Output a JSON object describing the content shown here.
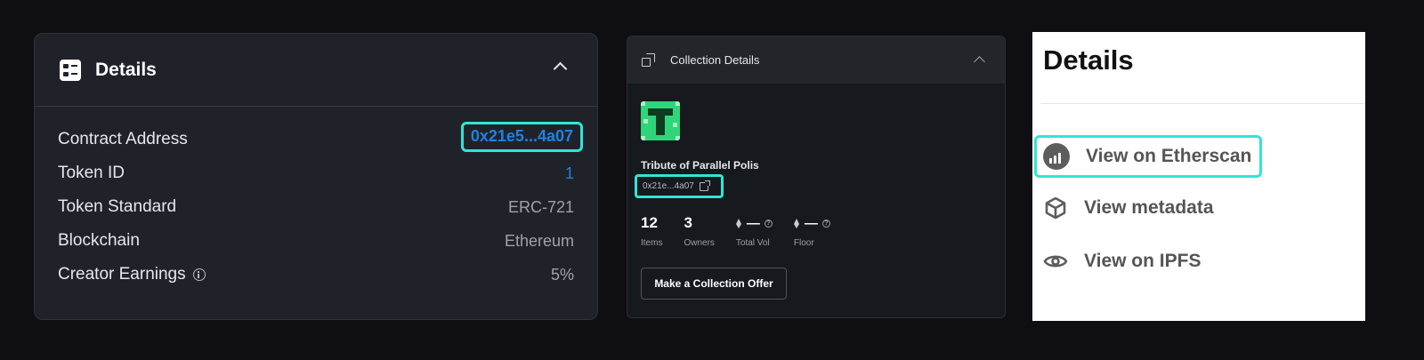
{
  "panel1": {
    "title": "Details",
    "rows": [
      {
        "label": "Contract Address",
        "value": "0x21e5...4a07"
      },
      {
        "label": "Token ID",
        "value": "1"
      },
      {
        "label": "Token Standard",
        "value": "ERC-721"
      },
      {
        "label": "Blockchain",
        "value": "Ethereum"
      },
      {
        "label": "Creator Earnings",
        "value": "5%"
      }
    ]
  },
  "panel2": {
    "title": "Collection Details",
    "collection_name": "Tribute of Parallel Polis",
    "address": "0x21e...4a07",
    "stats": [
      {
        "value": "12",
        "label": "Items"
      },
      {
        "value": "3",
        "label": "Owners"
      },
      {
        "value": "—",
        "label": "Total Vol"
      },
      {
        "value": "—",
        "label": "Floor"
      }
    ],
    "offer_button": "Make a Collection Offer"
  },
  "panel3": {
    "title": "Details",
    "links": [
      {
        "label": "View on Etherscan",
        "icon": "etherscan-icon"
      },
      {
        "label": "View metadata",
        "icon": "cube-icon"
      },
      {
        "label": "View on IPFS",
        "icon": "eye-icon"
      }
    ]
  },
  "colors": {
    "highlight": "#2ee6d6",
    "link_blue": "#2081e2",
    "avatar_green": "#2fd57a"
  }
}
